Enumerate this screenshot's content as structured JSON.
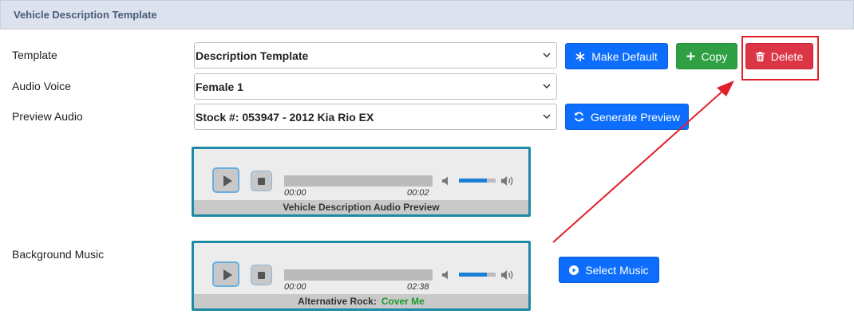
{
  "panel": {
    "title": "Vehicle Description Template"
  },
  "form": {
    "template": {
      "label": "Template",
      "value": "Description Template"
    },
    "audio_voice": {
      "label": "Audio Voice",
      "value": "Female 1"
    },
    "preview_audio": {
      "label": "Preview Audio",
      "value": "Stock #: 053947 - 2012 Kia Rio EX"
    },
    "background_music": {
      "label": "Background Music"
    }
  },
  "buttons": {
    "make_default": "Make Default",
    "copy": "Copy",
    "delete": "Delete",
    "generate_preview": "Generate Preview",
    "select_music": "Select Music"
  },
  "preview_player": {
    "current_time": "00:00",
    "duration": "00:02",
    "volume_fraction": 0.75,
    "caption": "Vehicle Description Audio Preview"
  },
  "music_player": {
    "current_time": "00:00",
    "duration": "02:38",
    "volume_fraction": 0.75,
    "genre": "Alternative Rock:",
    "song": "Cover Me"
  },
  "colors": {
    "primary": "#0d6efd",
    "success": "#2ea043",
    "danger": "#dc3545",
    "annotation": "#e0202a",
    "player_border": "#1f8aa6",
    "song_title": "#1a9a2a"
  },
  "icons": {
    "make_default": "asterisk-icon",
    "copy": "plus-icon",
    "delete": "trash-icon",
    "generate_preview": "refresh-icon",
    "select_music": "play-circle-icon"
  }
}
